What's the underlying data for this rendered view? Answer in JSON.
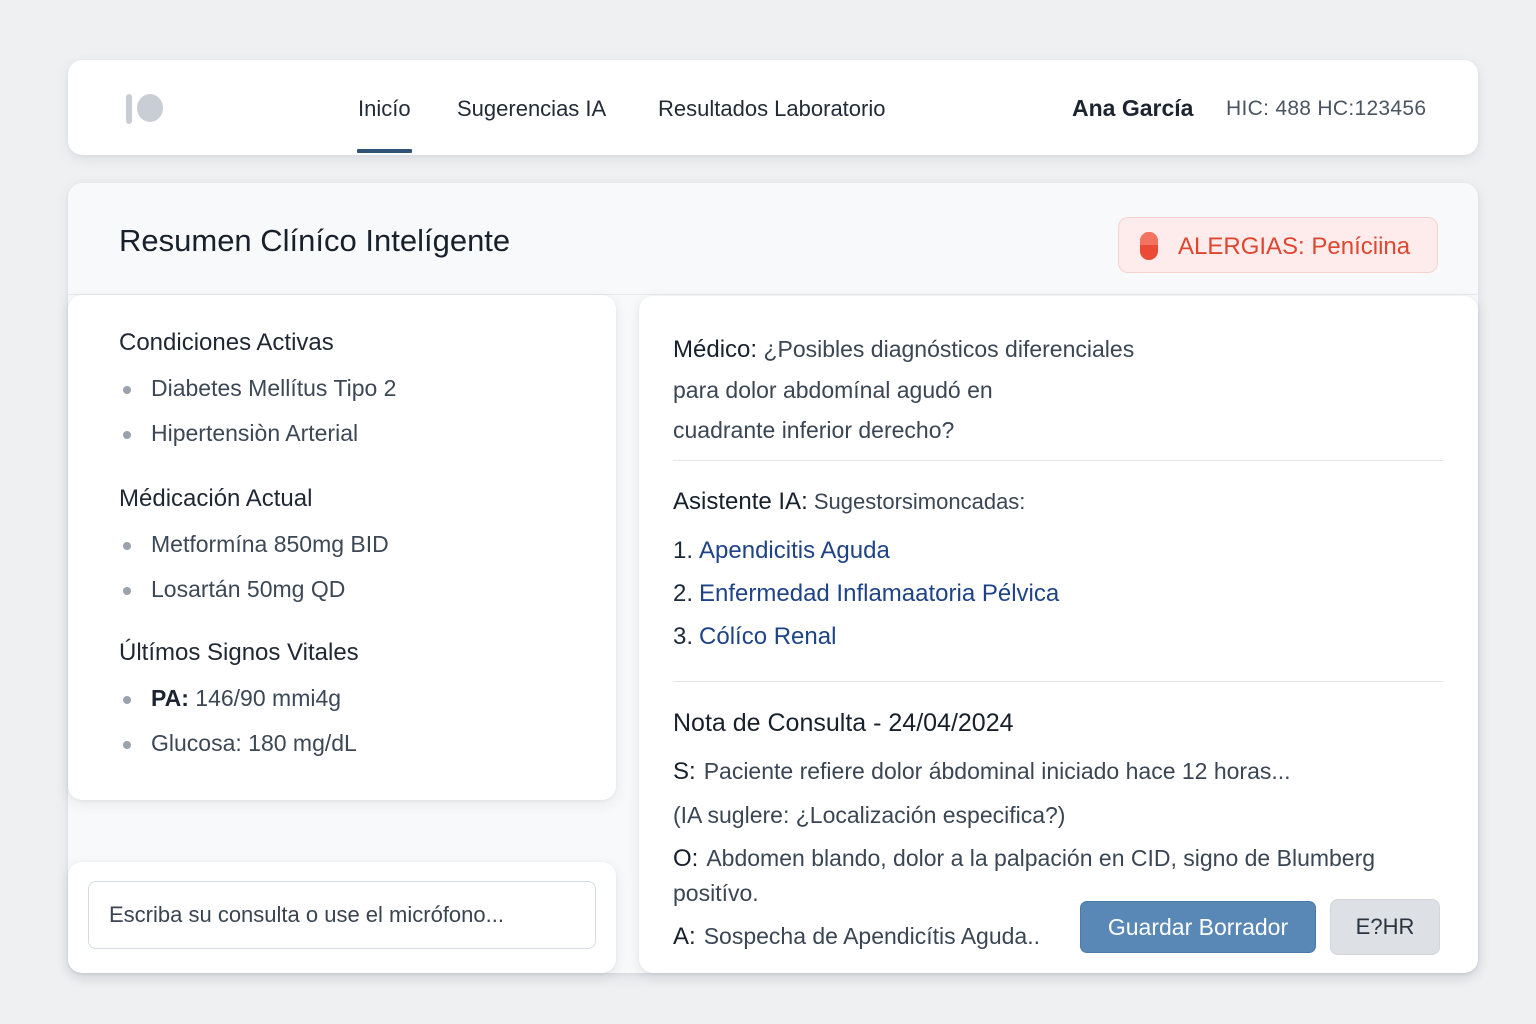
{
  "nav": {
    "tabs": [
      {
        "label": "Inicío",
        "active": true
      },
      {
        "label": "Sugerencias IA",
        "active": false
      },
      {
        "label": "Resultados Laboratorio",
        "active": false
      }
    ],
    "user_name": "Ana García",
    "user_ids": "HIC: 488  HC:123456"
  },
  "header": {
    "title": "Resumen Clíníco Intelígente",
    "allergy_label": "ALERGIAS: Peníciina",
    "allergy_icon": "pill-icon"
  },
  "summary": {
    "conditions_title": "Condiciones Activas",
    "conditions": [
      "Diabetes Mellítus Tipo 2",
      "Hipertensiòn Arterial"
    ],
    "medication_title": "Médicación Actual",
    "medications": [
      "Metformína 850mg BID",
      "Losartán 50mg QD"
    ],
    "vitals_title": "Últímos Signos Vitales",
    "vitals": [
      {
        "label": "PA:",
        "value": "146/90 mmi4g"
      },
      {
        "label": "",
        "value": "Glucosa: 180 mg/dL"
      }
    ]
  },
  "query": {
    "placeholder": "Escriba su consulta o use el micrófono..."
  },
  "chat": {
    "doctor_label": "Médico:",
    "doctor_lines": [
      "¿Posibles diagnósticos diferenciales",
      "para dolor abdomínal agudó en",
      "cuadrante inferior derecho?"
    ],
    "ai_label": "Asistente IA:",
    "ai_intro": "Sugestorsimoncadas:",
    "diagnoses": [
      {
        "num": "1.",
        "label": "Apendicitis Aguda"
      },
      {
        "num": "2.",
        "label": "Enfermedad Inflamaatoria Pélvica"
      },
      {
        "num": "3.",
        "label": "Cólíco Renal"
      }
    ]
  },
  "note": {
    "title": "Nota de Consulta - 24/04/2024",
    "s_label": "S:",
    "s_text": "Paciente refiere dolor ábdominal iniciado hace 12 horas...",
    "ai_hint": "(IA suglere: ¿Localización especifica?)",
    "o_label": "O:",
    "o_text_1": "Abdomen blando, dolor a la palpación en CID, signo de Blumberg",
    "o_text_2": "positívo.",
    "a_label": "A:",
    "a_text": "Sospecha de Apendicítis Aguda..",
    "save_button": "Guardar Borrador",
    "ehr_button": "E?HR"
  },
  "colors": {
    "accent": "#2f5276",
    "allergy": "#e0462f",
    "save_button": "#5a88b6",
    "link": "#1e4387"
  }
}
